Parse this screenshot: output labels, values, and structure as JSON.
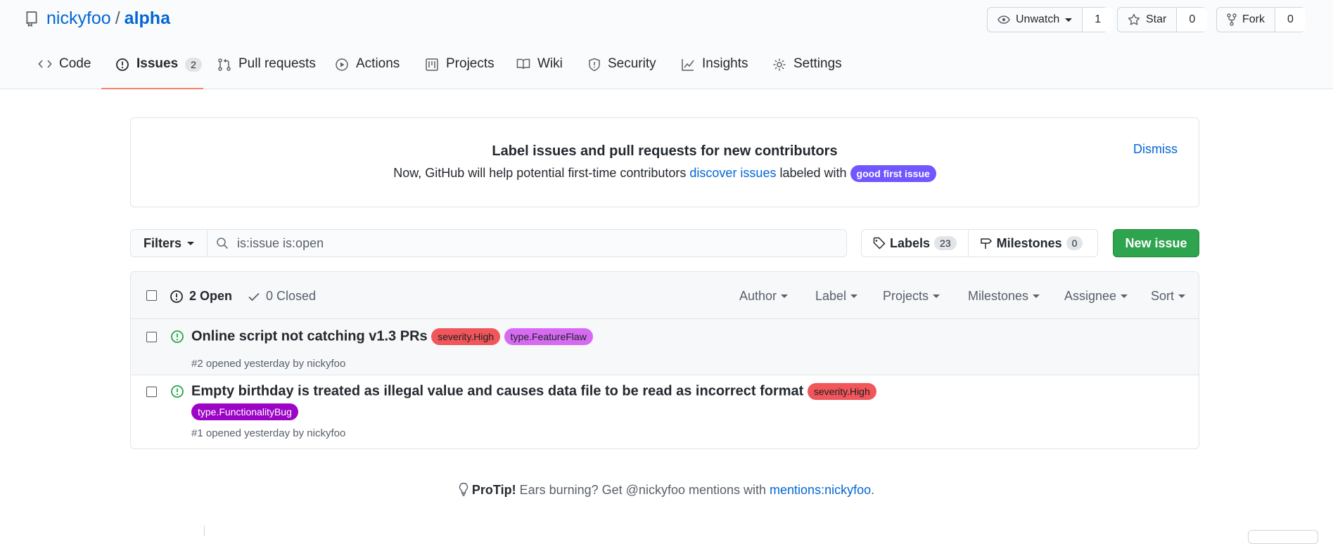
{
  "repo": {
    "owner": "nickyfoo",
    "separator": "/",
    "name": "alpha"
  },
  "header_buttons": {
    "unwatch": {
      "label": "Unwatch",
      "count": "1"
    },
    "star": {
      "label": "Star",
      "count": "0"
    },
    "fork": {
      "label": "Fork",
      "count": "0"
    }
  },
  "tabs": [
    {
      "label": "Code",
      "icon": "code-icon"
    },
    {
      "label": "Issues",
      "icon": "issue-opened-icon",
      "counter": "2",
      "selected": true
    },
    {
      "label": "Pull requests",
      "icon": "pull-request-icon"
    },
    {
      "label": "Actions",
      "icon": "play-icon"
    },
    {
      "label": "Projects",
      "icon": "project-icon"
    },
    {
      "label": "Wiki",
      "icon": "book-icon"
    },
    {
      "label": "Security",
      "icon": "shield-icon"
    },
    {
      "label": "Insights",
      "icon": "graph-icon"
    },
    {
      "label": "Settings",
      "icon": "gear-icon"
    }
  ],
  "banner": {
    "title": "Label issues and pull requests for new contributors",
    "text_before": "Now, GitHub will help potential first-time contributors",
    "link": "discover issues",
    "text_after": "labeled with",
    "label": "good first issue",
    "dismiss": "Dismiss"
  },
  "filters": {
    "button": "Filters",
    "search_value": "is:issue is:open"
  },
  "labels_button": {
    "label": "Labels",
    "count": "23"
  },
  "milestones_button": {
    "label": "Milestones",
    "count": "0"
  },
  "new_issue_button": "New issue",
  "list_header": {
    "open": "2 Open",
    "closed": "0 Closed",
    "menus": [
      "Author",
      "Label",
      "Projects",
      "Milestones",
      "Assignee",
      "Sort"
    ]
  },
  "issues": [
    {
      "title": "Online script not catching v1.3 PRs",
      "labels": [
        {
          "name": "severity.High",
          "color": "#f0565a"
        },
        {
          "name": "type.FeatureFlaw",
          "color": "#d66bf2"
        }
      ],
      "meta": "#2 opened yesterday by nickyfoo"
    },
    {
      "title": "Empty birthday is treated as illegal value and causes data file to be read as incorrect format",
      "labels": [
        {
          "name": "severity.High",
          "color": "#f0565a"
        },
        {
          "name": "type.FunctionalityBug",
          "color": "#9c05c6"
        }
      ],
      "meta": "#1 opened yesterday by nickyfoo"
    }
  ],
  "protip": {
    "strong": "ProTip!",
    "text": "Ears burning? Get @nickyfoo mentions with",
    "link": "mentions:nickyfoo",
    "end": "."
  },
  "colors": {
    "link": "#0366d6",
    "primary_button": "#2ea44f",
    "open_issue": "#28a745",
    "selected_tab_underline": "#f9826c"
  }
}
